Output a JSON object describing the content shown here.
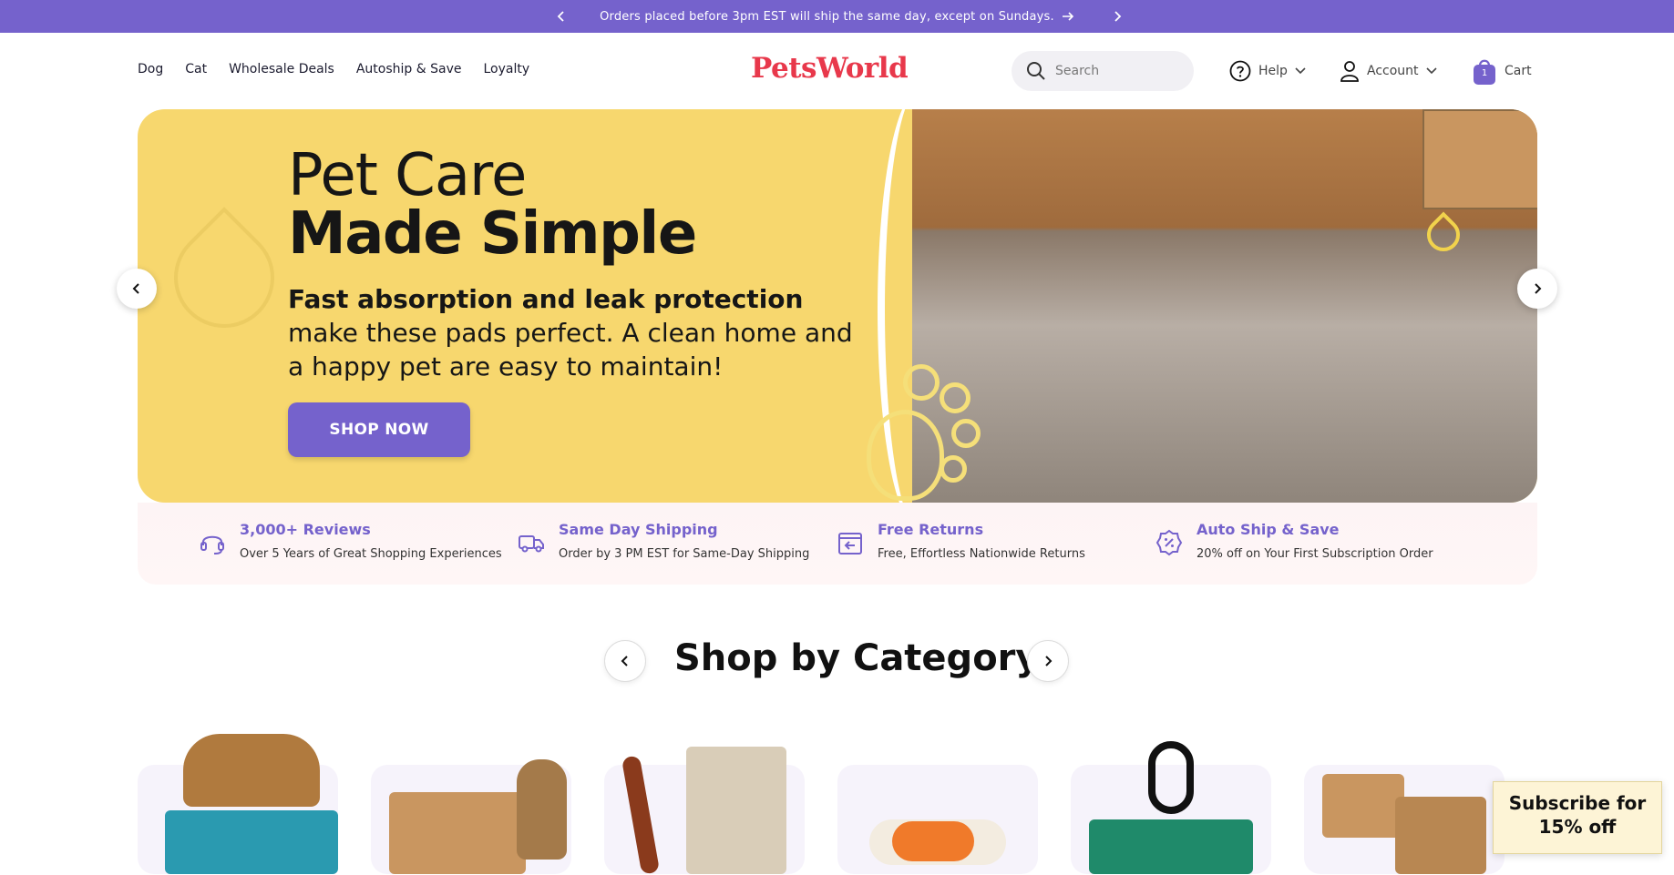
{
  "announcement": {
    "text": "Orders placed before 3pm EST will ship the same day, except on Sundays.",
    "prev_icon": "chevron-left-icon",
    "next_icon": "chevron-right-icon"
  },
  "nav": {
    "items": [
      "Dog",
      "Cat",
      "Wholesale Deals",
      "Autoship & Save",
      "Loyalty"
    ]
  },
  "brand": {
    "name": "PetsWorld",
    "color": "#e8384b"
  },
  "search": {
    "placeholder": "Search"
  },
  "header_links": {
    "help": "Help",
    "account": "Account",
    "cart": "Cart",
    "cart_count": "1"
  },
  "hero": {
    "title_line1": "Pet Care",
    "title_line2": "Made Simple",
    "subtitle_bold": "Fast absorption and leak protection",
    "subtitle_rest": " make these pads perfect. A clean home and a happy pet are easy to maintain!",
    "cta": "SHOP NOW"
  },
  "features": [
    {
      "title": "3,000+ Reviews",
      "desc": "Over 5 Years of Great Shopping Experiences",
      "icon": "headset-icon"
    },
    {
      "title": "Same Day Shipping",
      "desc": "Order by 3 PM EST for Same-Day Shipping",
      "icon": "truck-icon"
    },
    {
      "title": "Free Returns",
      "desc": "Free, Effortless Nationwide Returns",
      "icon": "return-box-icon"
    },
    {
      "title": "Auto Ship & Save",
      "desc": "20% off on Your First Subscription Order",
      "icon": "discount-badge-icon"
    }
  ],
  "category_section": {
    "title": "Shop by Category"
  },
  "subscribe_popup": {
    "text": "Subscribe for 15% off"
  },
  "colors": {
    "accent": "#7562cc",
    "hero_bg": "#f7d76e"
  }
}
